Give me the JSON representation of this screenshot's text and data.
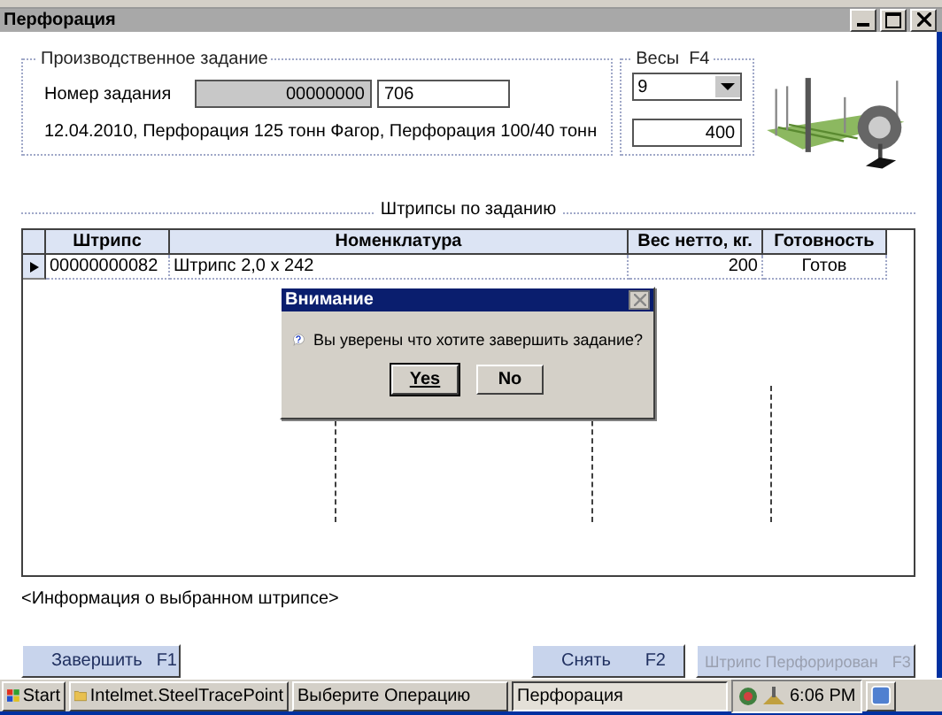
{
  "window": {
    "title": "Перфорация"
  },
  "task_group": {
    "title": "Производственное задание",
    "label": "Номер задания",
    "code": "00000000",
    "number": "706",
    "description": "12.04.2010, Перфорация 125 тонн Фагор, Перфорация 100/40 тонн"
  },
  "scales_group": {
    "title": "Весы  F4",
    "selected_scale": "9",
    "weight": "400"
  },
  "table": {
    "title": "Штрипсы по заданию",
    "columns": [
      "Штрипс",
      "Номенклатура",
      "Вес нетто, кг.",
      "Готовность"
    ],
    "rows": [
      {
        "selected": true,
        "cells": [
          "00000000082",
          "Штрипс 2,0 x 242",
          "200",
          "Готов"
        ]
      }
    ]
  },
  "dialog": {
    "title": "Внимание",
    "message": "Вы уверены что хотите завершить задание?",
    "buttons": [
      "Yes",
      "No"
    ]
  },
  "info_text": "<Информация о выбранном штрипсе>",
  "buttons": [
    {
      "label": "Завершить",
      "key": "F1",
      "disabled": false
    },
    {
      "label": "Снять",
      "key": "F2",
      "disabled": false
    },
    {
      "label": "Штрипс Перфорирован",
      "key": "F3",
      "disabled": true
    }
  ],
  "taskbar": {
    "start": "Start",
    "tasks": [
      {
        "label": "Intelmet.SteelTracePoint",
        "selected": false
      },
      {
        "label": "Выберите Операцию",
        "selected": false
      },
      {
        "label": "Перфорация",
        "selected": true
      }
    ],
    "clock": "6:06 PM"
  }
}
